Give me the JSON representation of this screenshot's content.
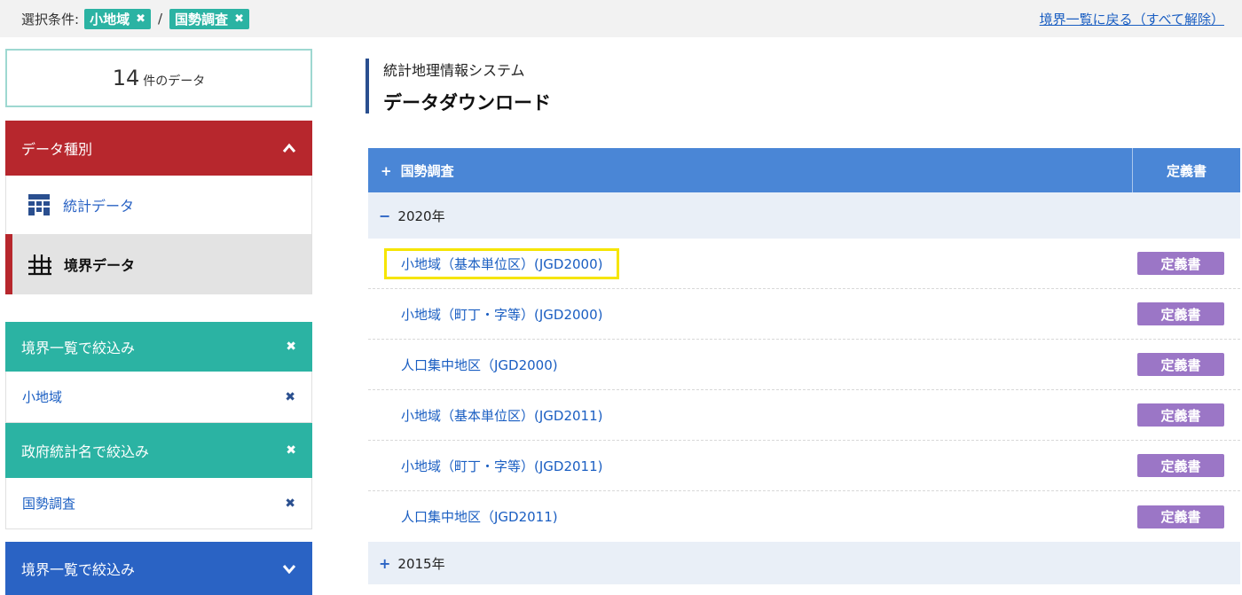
{
  "topbar": {
    "label": "選択条件:",
    "tags": [
      "小地域",
      "国勢調査"
    ],
    "separator": "/",
    "reset_link": "境界一覧に戻る（すべて解除）",
    "remove_glyph": "✖"
  },
  "count": {
    "number": "14",
    "unit": "件のデータ"
  },
  "data_type_panel": {
    "title": "データ種別",
    "items": [
      {
        "label": "統計データ",
        "icon": "table-icon"
      },
      {
        "label": "境界データ",
        "icon": "grid-icon",
        "selected": true
      }
    ]
  },
  "filters": [
    {
      "title": "境界一覧で絞込み",
      "value": "小地域"
    },
    {
      "title": "政府統計名で絞込み",
      "value": "国勢調査"
    }
  ],
  "bottom_panel": {
    "title": "境界一覧で絞込み"
  },
  "header": {
    "subtitle": "統計地理情報システム",
    "title": "データダウンロード"
  },
  "table": {
    "group_title": "国勢調査",
    "group_symbol": "+",
    "definition_header": "定義書",
    "years": [
      {
        "label": "2020年",
        "symbol": "−",
        "rows": [
          "小地域（基本単位区）(JGD2000)",
          "小地域（町丁・字等）(JGD2000)",
          "人口集中地区（JGD2000)",
          "小地域（基本単位区）(JGD2011)",
          "小地域（町丁・字等）(JGD2011)",
          "人口集中地区（JGD2011)"
        ],
        "button_label": "定義書"
      },
      {
        "label": "2015年",
        "symbol": "+"
      }
    ]
  },
  "colors": {
    "teal": "#2bb3a3",
    "red": "#b7272d",
    "blue": "#2a63c4",
    "table_header": "#4a86d6",
    "purple": "#9b76c6",
    "highlight": "#f6e500"
  }
}
